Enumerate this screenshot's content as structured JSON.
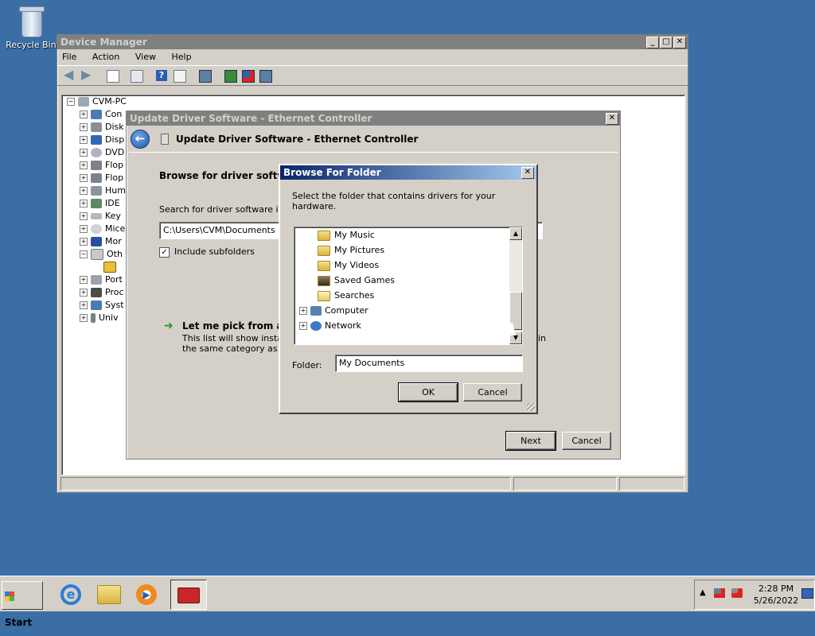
{
  "desktop": {
    "recycle_bin_label": "Recycle Bin"
  },
  "device_manager": {
    "title": "Device Manager",
    "menu": [
      "File",
      "Action",
      "View",
      "Help"
    ],
    "tree": {
      "root": "CVM-PC",
      "items": [
        "Con",
        "Disk",
        "Disp",
        "DVD",
        "Flop",
        "Flop",
        "Hum",
        "IDE",
        "Key",
        "Mice",
        "Mor",
        "Oth",
        "Port",
        "Proc",
        "Syst",
        "Univ"
      ]
    }
  },
  "update_driver": {
    "title": "Update Driver Software - Ethernet Controller",
    "header_title": "Update Driver Software - Ethernet Controller",
    "browse_heading": "Browse for driver software",
    "search_label": "Search for driver software in",
    "path_value": "C:\\Users\\CVM\\Documents",
    "include_subfolders_label": "Include subfolders",
    "include_subfolders_checked": true,
    "pick_link": "Let me pick from a lis",
    "pick_desc_line1": "This list will show installed",
    "pick_desc_line2": "the same category as the",
    "pick_desc_tail": "in",
    "next_label": "Next",
    "cancel_label": "Cancel"
  },
  "browse_folder": {
    "title": "Browse For Folder",
    "instruction": "Select the folder that contains drivers for your hardware.",
    "items": [
      {
        "label": "My Music",
        "expandable": false,
        "icon": "music-folder-icon"
      },
      {
        "label": "My Pictures",
        "expandable": false,
        "icon": "pictures-folder-icon"
      },
      {
        "label": "My Videos",
        "expandable": false,
        "icon": "videos-folder-icon"
      },
      {
        "label": "Saved Games",
        "expandable": false,
        "icon": "saved-games-folder-icon"
      },
      {
        "label": "Searches",
        "expandable": false,
        "icon": "searches-folder-icon"
      },
      {
        "label": "Computer",
        "expandable": true,
        "icon": "computer-icon"
      },
      {
        "label": "Network",
        "expandable": true,
        "icon": "network-icon"
      }
    ],
    "folder_label": "Folder:",
    "folder_value": "My Documents",
    "ok_label": "OK",
    "cancel_label": "Cancel"
  },
  "taskbar": {
    "start_label": "Start",
    "quick_launch": [
      "internet-explorer-icon",
      "windows-explorer-icon",
      "media-player-icon",
      "device-manager-task-icon"
    ],
    "clock_time": "2:28 PM",
    "clock_date": "5/26/2022"
  },
  "colors": {
    "desktop": "#3a6ea5",
    "active_title_start": "#0a246a",
    "active_title_end": "#a6caf0",
    "inactive_title": "#808080",
    "chrome": "#d4d0c8"
  }
}
